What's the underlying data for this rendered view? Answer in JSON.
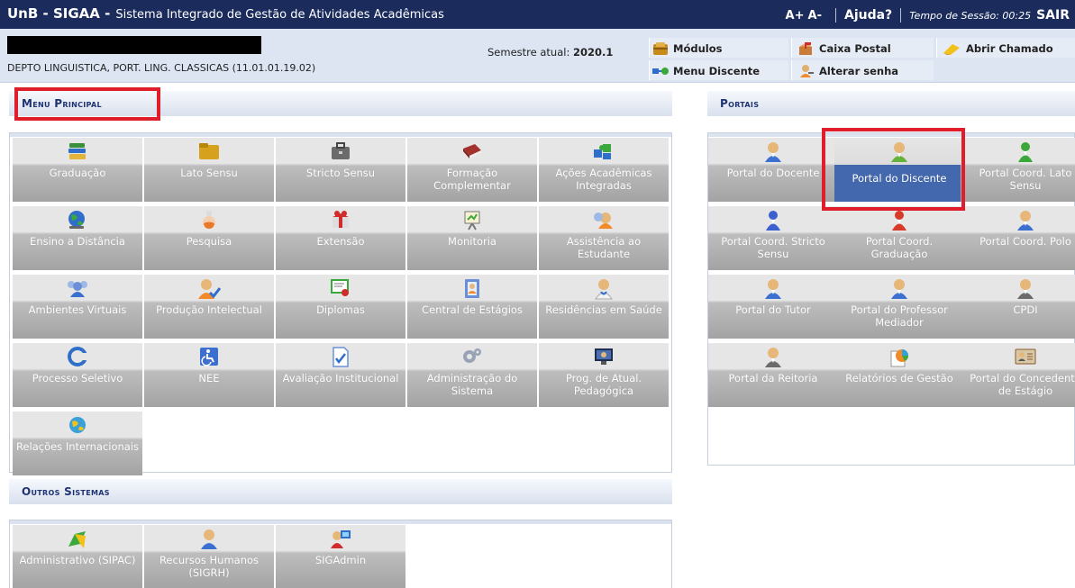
{
  "topbar": {
    "app": "UnB - SIGAA -",
    "system_name": "Sistema Integrado de Gestão de Atividades Acadêmicas",
    "font_up": "A+",
    "font_down": "A-",
    "help": "Ajuda?",
    "session_label": "Tempo de Sessão: 00:25",
    "logout": "SAIR"
  },
  "info": {
    "department": "DEPTO LINGUISTICA, PORT. LING. CLASSICAS (11.01.01.19.02)",
    "semester_label": "Semestre atual:",
    "semester_value": "2020.1"
  },
  "quick_links": {
    "modules": "Módulos",
    "mailbox": "Caixa Postal",
    "open_ticket": "Abrir Chamado",
    "student_menu": "Menu Discente",
    "change_password": "Alterar senha"
  },
  "sections": {
    "main_menu": "Menu Principal",
    "portals": "Portais",
    "other_systems": "Outros Sistemas"
  },
  "main_menu_items": [
    {
      "label": "Graduação",
      "icon": "books-icon"
    },
    {
      "label": "Lato Sensu",
      "icon": "folder-icon"
    },
    {
      "label": "Stricto Sensu",
      "icon": "briefcase-icon"
    },
    {
      "label": "Formação Complementar",
      "icon": "book-icon"
    },
    {
      "label": "Ações Acadêmicas Integradas",
      "icon": "puzzle-icon"
    },
    {
      "label": "Ensino a Distância",
      "icon": "globe-icon"
    },
    {
      "label": "Pesquisa",
      "icon": "flask-icon"
    },
    {
      "label": "Extensão",
      "icon": "gift-icon"
    },
    {
      "label": "Monitoria",
      "icon": "presentation-icon"
    },
    {
      "label": "Assistência ao Estudante",
      "icon": "support-icon"
    },
    {
      "label": "Ambientes Virtuais",
      "icon": "users-network-icon"
    },
    {
      "label": "Produção Intelectual",
      "icon": "user-check-icon"
    },
    {
      "label": "Diplomas",
      "icon": "certificate-icon"
    },
    {
      "label": "Central de Estágios",
      "icon": "address-book-icon"
    },
    {
      "label": "Residências em Saúde",
      "icon": "doctor-icon"
    },
    {
      "label": "Processo Seletivo",
      "icon": "selection-icon"
    },
    {
      "label": "NEE",
      "icon": "accessibility-icon"
    },
    {
      "label": "Avaliação Institucional",
      "icon": "evaluation-icon"
    },
    {
      "label": "Administração do Sistema",
      "icon": "gears-icon"
    },
    {
      "label": "Prog. de Atual. Pedagógica",
      "icon": "monitor-icon"
    },
    {
      "label": "Relações Internacionais",
      "icon": "world-icon"
    }
  ],
  "portal_items": [
    {
      "label": "Portal do Docente",
      "icon": "teacher-icon",
      "color": "#3b6fd0"
    },
    {
      "label": "Portal do Discente",
      "icon": "student-icon",
      "color": "#66b13a",
      "selected": true
    },
    {
      "label": "Portal Coord. Lato Sensu",
      "icon": "coordinator-icon",
      "color": "#3aa83a"
    },
    {
      "label": "Portal Coord. Stricto Sensu",
      "icon": "coordinator-icon",
      "color": "#3a5fcf"
    },
    {
      "label": "Portal Coord. Graduação",
      "icon": "coordinator-icon",
      "color": "#d83a2a"
    },
    {
      "label": "Portal Coord. Polo",
      "icon": "user-icon",
      "color": "#3b6fd0"
    },
    {
      "label": "Portal do Tutor",
      "icon": "tutor-icon",
      "color": "#3b6fd0"
    },
    {
      "label": "Portal do Professor Mediador",
      "icon": "mediator-icon",
      "color": "#3b6fd0"
    },
    {
      "label": "CPDI",
      "icon": "manager-icon",
      "color": "#6b6b6b"
    },
    {
      "label": "Portal da Reitoria",
      "icon": "manager-icon",
      "color": "#6b6b6b"
    },
    {
      "label": "Relatórios de Gestão",
      "icon": "reports-icon",
      "color": "#2fa3d6"
    },
    {
      "label": "Portal do Concedente de Estágio",
      "icon": "id-card-icon",
      "color": "#8a5a2b"
    }
  ],
  "other_systems_items": [
    {
      "label": "Administrativo (SIPAC)",
      "icon": "admin-icon"
    },
    {
      "label": "Recursos Humanos (SIGRH)",
      "icon": "hr-icon"
    },
    {
      "label": "SIGAdmin",
      "icon": "sigadmin-icon"
    }
  ],
  "colors": {
    "topbar": "#1a2b5c",
    "header_text": "#1f3373",
    "selected_tile": "#4468ad",
    "highlight_box": "#e01e2b"
  }
}
